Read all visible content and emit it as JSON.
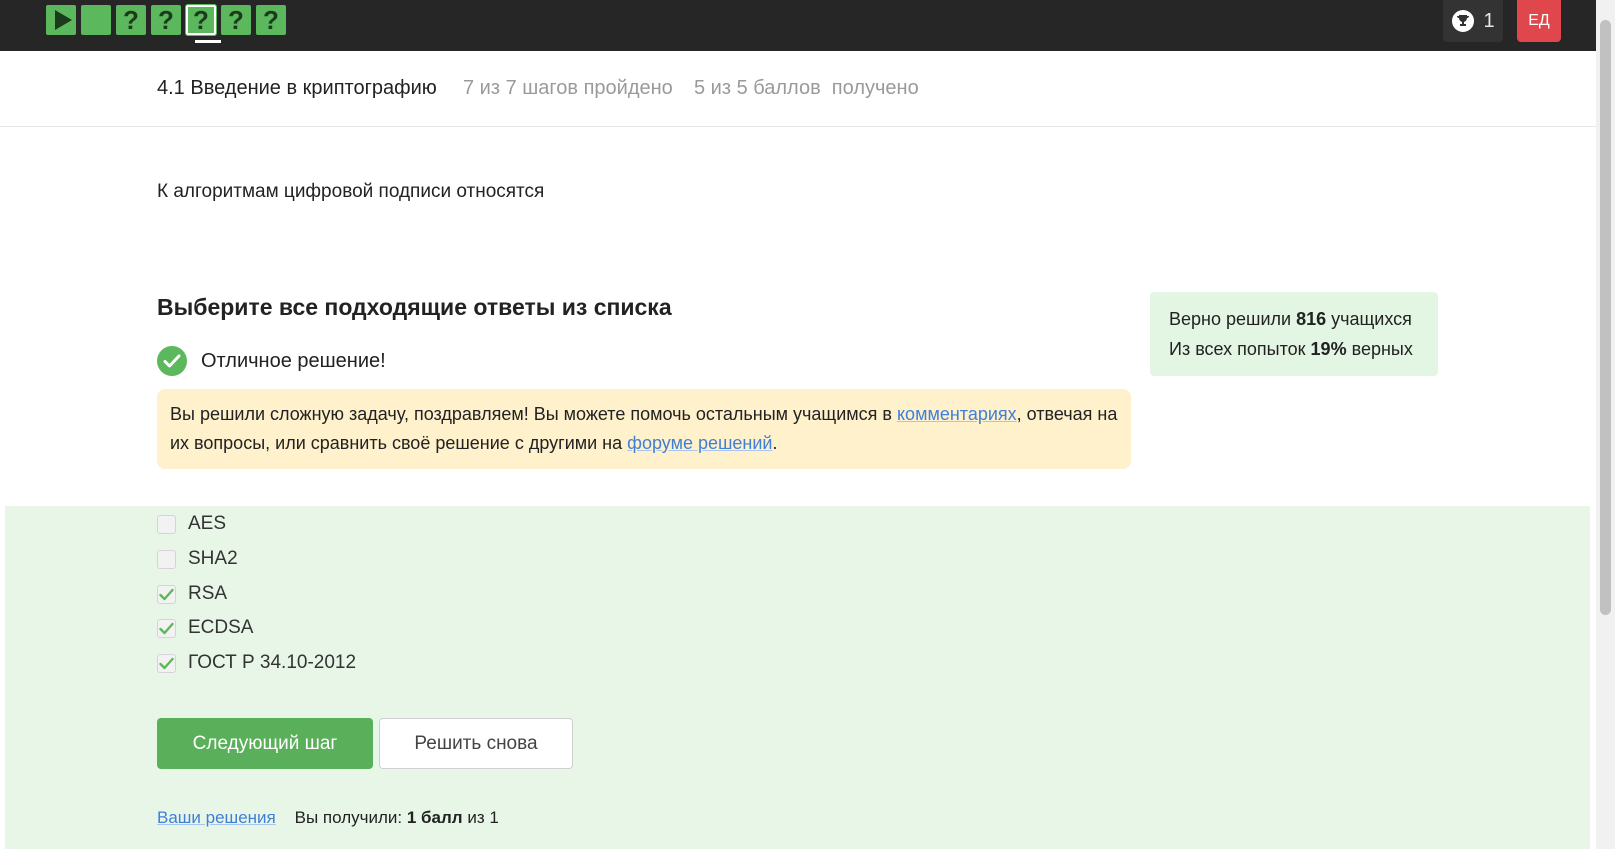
{
  "topbar": {
    "steps": [
      {
        "type": "play",
        "label": ""
      },
      {
        "type": "done",
        "label": ""
      },
      {
        "type": "quiz",
        "label": "?"
      },
      {
        "type": "quiz",
        "label": "?"
      },
      {
        "type": "quiz",
        "label": "?"
      },
      {
        "type": "quiz",
        "label": "?"
      },
      {
        "type": "quiz",
        "label": "?"
      }
    ],
    "current_step": 5,
    "trophy_count": "1",
    "avatar_initials": "ЕД"
  },
  "lesson": {
    "title": "4.1 Введение в криптографию",
    "progress": "7 из 7 шагов пройдено",
    "points": "5 из 5 баллов  получено"
  },
  "question": {
    "text": "К алгоритмам цифровой подписи относятся",
    "heading": "Выберите все подходящие ответы из списка",
    "status": "Отличное решение!"
  },
  "notice": {
    "text_before": "Вы решили сложную задачу, поздравляем! Вы можете помочь остальным учащимся в ",
    "link1": "комментариях",
    "text_middle": ", отвечая на их вопросы, или сравнить своё решение с другими на ",
    "link2": "форуме решений",
    "text_after": "."
  },
  "stats": {
    "line1_prefix": "Верно решили ",
    "solved_count": "816",
    "line1_suffix": " учащихся",
    "line2_prefix": "Из всех попыток ",
    "percent": "19%",
    "line2_suffix": " верных"
  },
  "options": [
    {
      "label": "AES",
      "checked": false
    },
    {
      "label": "SHA2",
      "checked": false
    },
    {
      "label": "RSA",
      "checked": true
    },
    {
      "label": "ECDSA",
      "checked": true
    },
    {
      "label": "ГОСТ Р 34.10-2012",
      "checked": true
    }
  ],
  "buttons": {
    "next": "Следующий шаг",
    "retry": "Решить снова"
  },
  "footer": {
    "solutions_link": "Ваши решения",
    "received_prefix": "Вы получили: ",
    "score": "1 балл",
    "received_suffix": " из 1"
  },
  "colors": {
    "accent": "#5cb85c",
    "answer_bg": "#e7f6e7",
    "notice_bg": "#fff1cc",
    "avatar_bg": "#e0474c"
  }
}
